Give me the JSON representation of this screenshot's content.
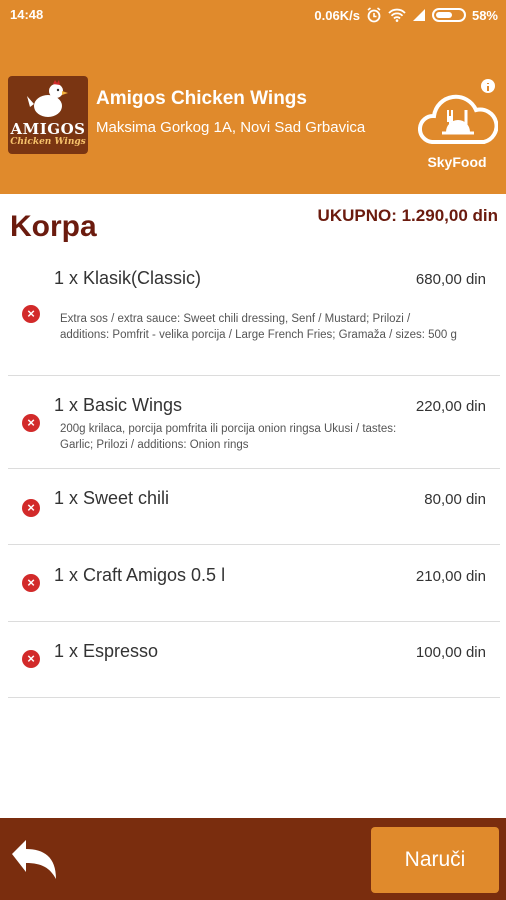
{
  "status_bar": {
    "time": "14:48",
    "speed": "0.06K/s",
    "battery": "58%"
  },
  "header": {
    "logo": {
      "word": "AMIGOS",
      "sub": "Chicken Wings"
    },
    "restaurant_name": "Amigos Chicken Wings",
    "address": "Maksima Gorkog 1A, Novi Sad Grbavica",
    "skyfood_label": "SkyFood"
  },
  "cart": {
    "title": "Korpa",
    "total": "UKUPNO: 1.290,00 din",
    "items": [
      {
        "name": "1 x Klasik(Classic)",
        "price": "680,00 din",
        "note": "Extra sos / extra sauce: Sweet chili dressing, Senf / Mustard; Prilozi / additions: Pomfrit - velika porcija / Large French Fries; Gramaža / sizes: 500 g"
      },
      {
        "name": "1 x Basic Wings",
        "price": "220,00 din",
        "note": "200g krilaca, porcija pomfrita ili porcija onion ringsa Ukusi / tastes: Garlic; Prilozi / additions: Onion rings"
      },
      {
        "name": "1 x Sweet chili",
        "price": "80,00 din",
        "note": ""
      },
      {
        "name": "1 x Craft Amigos 0.5 l",
        "price": "210,00 din",
        "note": ""
      },
      {
        "name": "1 x Espresso",
        "price": "100,00 din",
        "note": ""
      }
    ]
  },
  "footer": {
    "order_label": "Naruči"
  },
  "colors": {
    "accent": "#e08a2c",
    "brand_dark": "#7a2d0e",
    "title": "#6b1b0e",
    "remove": "#d22a2a"
  }
}
